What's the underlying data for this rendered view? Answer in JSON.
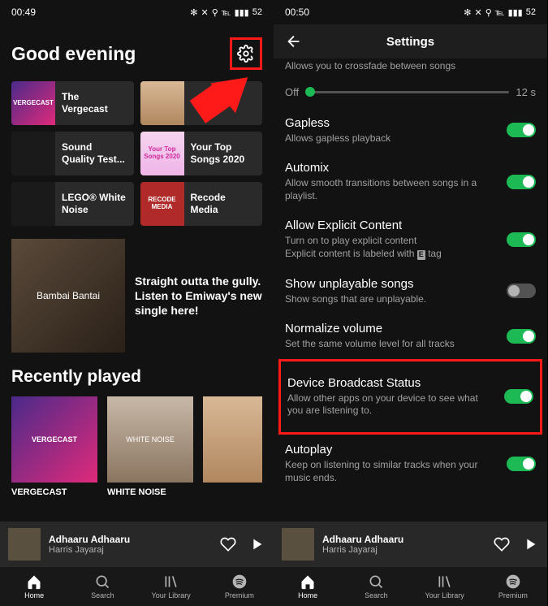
{
  "left": {
    "status": {
      "time": "00:49",
      "battery": "52"
    },
    "greeting": "Good evening",
    "tiles": [
      {
        "label": "The Vergecast",
        "art": "art-vergecast",
        "art_text": "VERGECAST"
      },
      {
        "label": "",
        "art": "art-devd",
        "art_text": ""
      },
      {
        "label": "Sound Quality Test...",
        "art": "art-sound",
        "art_text": ""
      },
      {
        "label": "Your Top Songs 2020",
        "art": "art-yourtop",
        "art_text": "Your Top Songs 2020"
      },
      {
        "label": "LEGO® White Noise",
        "art": "art-lego",
        "art_text": ""
      },
      {
        "label": "Recode Media",
        "art": "art-recode",
        "art_text": "RECODE MEDIA"
      }
    ],
    "promo": {
      "art_text": "Bambai Bantai",
      "text": "Straight outta the gully. Listen to Emiway's new single here!"
    },
    "recent_title": "Recently played",
    "recent": [
      {
        "label": "VERGECAST",
        "art": "art-vergecast",
        "art_text": "VERGECAST"
      },
      {
        "label": "WHITE NOISE",
        "art": "art-whitenoise",
        "art_text": "WHITE NOISE"
      },
      {
        "label": "",
        "art": "art-devd",
        "art_text": ""
      }
    ],
    "now_playing": {
      "title": "Adhaaru Adhaaru",
      "artist": "Harris Jayaraj"
    },
    "nav": [
      {
        "label": "Home",
        "icon": "home",
        "active": true
      },
      {
        "label": "Search",
        "icon": "search",
        "active": false
      },
      {
        "label": "Your Library",
        "icon": "library",
        "active": false
      },
      {
        "label": "Premium",
        "icon": "spotify",
        "active": false
      }
    ]
  },
  "right": {
    "status": {
      "time": "00:50",
      "battery": "52"
    },
    "header": "Settings",
    "partial_top": {
      "title_cut": "",
      "sub": "Allows you to crossfade between songs"
    },
    "slider": {
      "left": "Off",
      "right": "12 s"
    },
    "settings": [
      {
        "title": "Gapless",
        "sub": "Allows gapless playback",
        "on": true
      },
      {
        "title": "Automix",
        "sub": "Allow smooth transitions between songs in a playlist.",
        "on": true
      },
      {
        "title": "Allow Explicit Content",
        "sub_a": "Turn on to play explicit content",
        "sub_b": "Explicit content is labeled with",
        "sub_c": "tag",
        "on": true,
        "explicit": true
      },
      {
        "title": "Show unplayable songs",
        "sub": "Show songs that are unplayable.",
        "on": false
      },
      {
        "title": "Normalize volume",
        "sub": "Set the same volume level for all tracks",
        "on": true
      },
      {
        "title": "Device Broadcast Status",
        "sub": "Allow other apps on your device to see what you are listening to.",
        "on": true,
        "highlight": true
      },
      {
        "title": "Autoplay",
        "sub": "Keep on listening to similar tracks when your music ends.",
        "on": true
      }
    ],
    "now_playing": {
      "title": "Adhaaru Adhaaru",
      "artist": "Harris Jayaraj"
    },
    "nav": [
      {
        "label": "Home",
        "icon": "home",
        "active": true
      },
      {
        "label": "Search",
        "icon": "search",
        "active": false
      },
      {
        "label": "Your Library",
        "icon": "library",
        "active": false
      },
      {
        "label": "Premium",
        "icon": "spotify",
        "active": false
      }
    ]
  }
}
